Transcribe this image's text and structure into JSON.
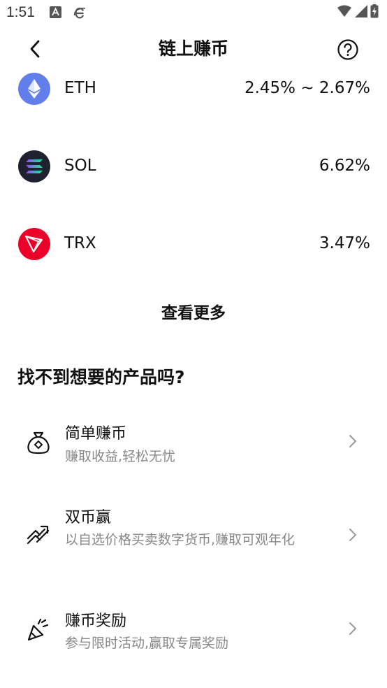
{
  "status_bar": {
    "time": "1:51"
  },
  "header": {
    "title": "链上赚币"
  },
  "coins": [
    {
      "name": "ETH",
      "apy": "2.45% ~ 2.67%",
      "icon": "eth-icon",
      "color": "#627EEA"
    },
    {
      "name": "SOL",
      "apy": "6.62%",
      "icon": "sol-icon",
      "color": "#1F2131"
    },
    {
      "name": "TRX",
      "apy": "3.47%",
      "icon": "trx-icon",
      "color": "#EB0029"
    }
  ],
  "see_more": "查看更多",
  "section": {
    "title": "找不到想要的产品吗?"
  },
  "products": [
    {
      "title": "简单赚币",
      "desc": "赚取收益,轻松无忧",
      "icon": "money-bag-icon"
    },
    {
      "title": "双币赢",
      "desc": "以自选价格买卖数字货币,赚取可观年化",
      "icon": "dual-currency-icon"
    },
    {
      "title": "赚币奖励",
      "desc": "参与限时活动,赢取专属奖励",
      "icon": "party-popper-icon"
    }
  ]
}
